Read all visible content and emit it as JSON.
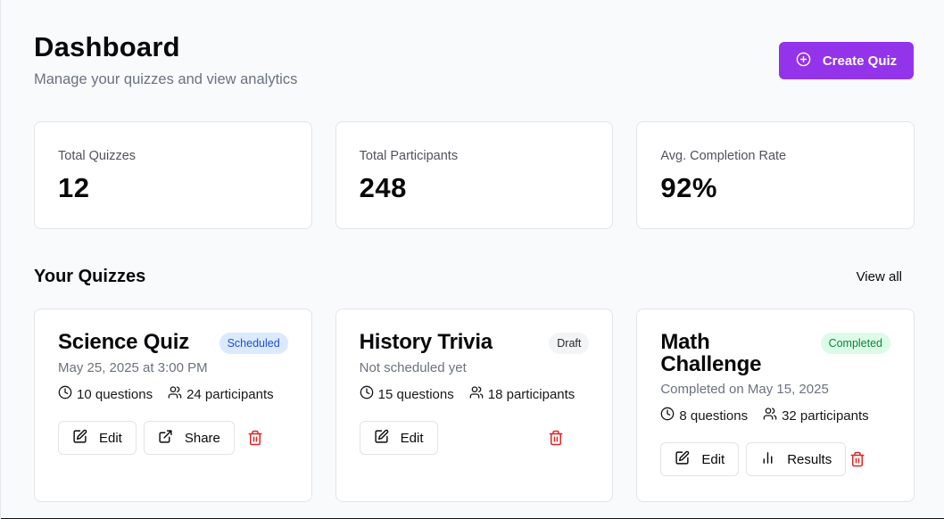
{
  "header": {
    "title": "Dashboard",
    "subtitle": "Manage your quizzes and view analytics",
    "create_label": "Create Quiz",
    "accent": "#9333ea"
  },
  "stats": [
    {
      "label": "Total Quizzes",
      "value": "12"
    },
    {
      "label": "Total Participants",
      "value": "248"
    },
    {
      "label": "Avg. Completion Rate",
      "value": "92%"
    }
  ],
  "section": {
    "title": "Your Quizzes",
    "view_all": "View all"
  },
  "quizzes": [
    {
      "title": "Science Quiz",
      "status": "Scheduled",
      "date": "May 25, 2025 at 3:00 PM",
      "questions": "10 questions",
      "participants": "24 participants",
      "actions": [
        "Edit",
        "Share"
      ]
    },
    {
      "title": "History Trivia",
      "status": "Draft",
      "date": "Not scheduled yet",
      "questions": "15 questions",
      "participants": "18 participants",
      "actions": [
        "Edit"
      ]
    },
    {
      "title": "Math Challenge",
      "status": "Completed",
      "date": "Completed on May 15, 2025",
      "questions": "8 questions",
      "participants": "32 participants",
      "actions": [
        "Edit",
        "Results"
      ]
    }
  ],
  "icons": {
    "create": "plus-circle-icon",
    "questions": "clock-icon",
    "participants": "users-icon",
    "edit": "edit-icon",
    "share": "external-link-icon",
    "results": "bar-chart-icon",
    "delete": "trash-icon"
  },
  "colors": {
    "scheduled_bg": "#dbeafe",
    "scheduled_text": "#1d4ed8",
    "draft_bg": "#f3f4f6",
    "completed_bg": "#dcfce7",
    "completed_text": "#15803d",
    "danger": "#dc2626"
  }
}
